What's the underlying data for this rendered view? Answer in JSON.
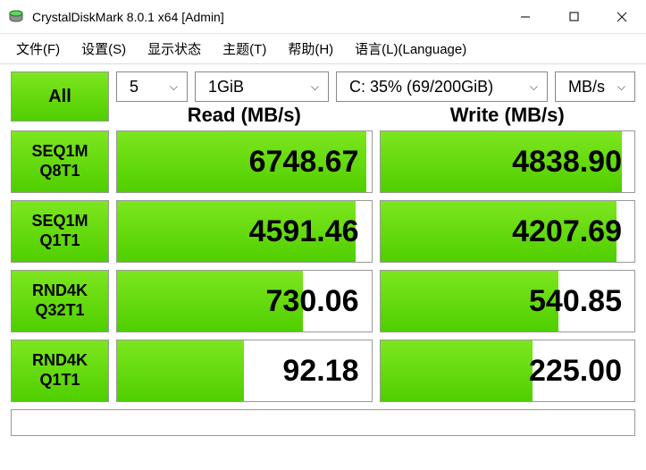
{
  "window": {
    "title": "CrystalDiskMark 8.0.1 x64 [Admin]"
  },
  "menu": {
    "file": "文件(F)",
    "settings": "设置(S)",
    "state": "显示状态",
    "theme": "主题(T)",
    "help": "帮助(H)",
    "language": "语言(L)(Language)"
  },
  "config": {
    "all_label": "All",
    "runs": "5",
    "size": "1GiB",
    "drive": "C: 35% (69/200GiB)",
    "unit": "MB/s"
  },
  "columns": {
    "read": "Read (MB/s)",
    "write": "Write (MB/s)"
  },
  "tests": [
    {
      "name1": "SEQ1M",
      "name2": "Q8T1",
      "read": "6748.67",
      "read_pct": 98,
      "write": "4838.90",
      "write_pct": 95
    },
    {
      "name1": "SEQ1M",
      "name2": "Q1T1",
      "read": "4591.46",
      "read_pct": 94,
      "write": "4207.69",
      "write_pct": 93
    },
    {
      "name1": "RND4K",
      "name2": "Q32T1",
      "read": "730.06",
      "read_pct": 73,
      "write": "540.85",
      "write_pct": 70
    },
    {
      "name1": "RND4K",
      "name2": "Q1T1",
      "read": "92.18",
      "read_pct": 50,
      "write": "225.00",
      "write_pct": 60
    }
  ],
  "chart_data": {
    "type": "table",
    "title": "CrystalDiskMark 8.0.1 x64 benchmark results (MB/s)",
    "drive": "C: 35% (69/200GiB)",
    "runs": 5,
    "test_size": "1GiB",
    "unit": "MB/s",
    "columns": [
      "Test",
      "Read (MB/s)",
      "Write (MB/s)"
    ],
    "rows": [
      {
        "test": "SEQ1M Q8T1",
        "read": 6748.67,
        "write": 4838.9
      },
      {
        "test": "SEQ1M Q1T1",
        "read": 4591.46,
        "write": 4207.69
      },
      {
        "test": "RND4K Q32T1",
        "read": 730.06,
        "write": 540.85
      },
      {
        "test": "RND4K Q1T1",
        "read": 92.18,
        "write": 225.0
      }
    ]
  }
}
